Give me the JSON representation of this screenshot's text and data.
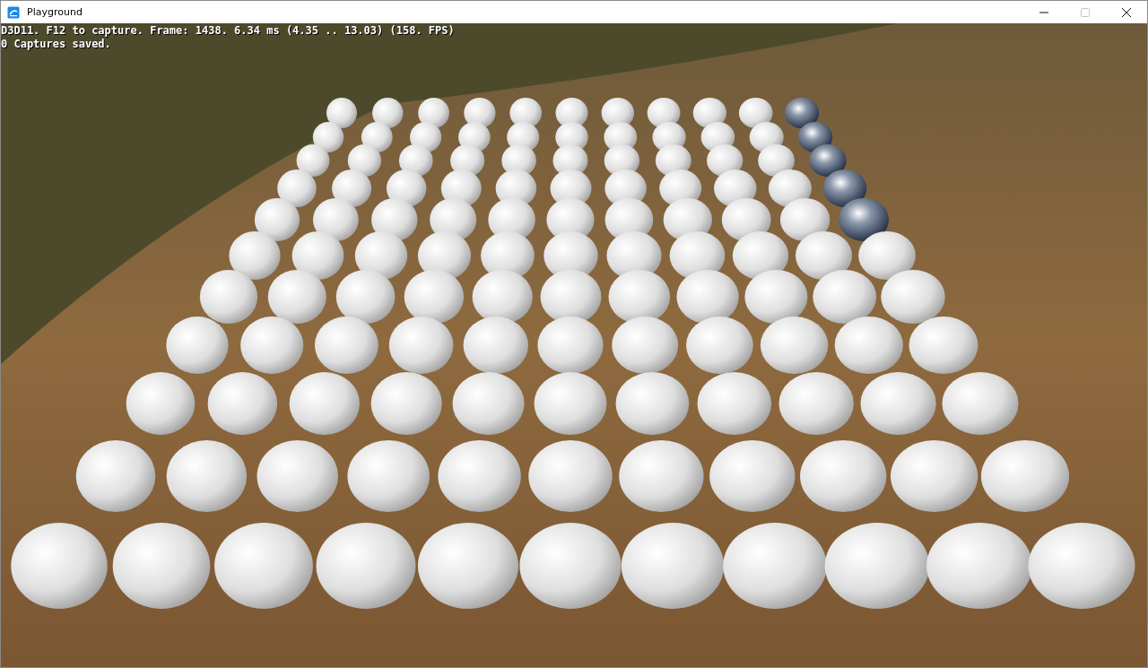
{
  "window": {
    "title": "Playground",
    "controls": [
      {
        "kind": "minimize",
        "disabled": false
      },
      {
        "kind": "maximize",
        "disabled": true
      },
      {
        "kind": "close",
        "disabled": false
      }
    ]
  },
  "overlay": {
    "lines": [
      "D3D11. F12 to capture. Frame: 1438. 6.34 ms (4.35 .. 13.03) (158. FPS)",
      "0 Captures saved."
    ]
  }
}
